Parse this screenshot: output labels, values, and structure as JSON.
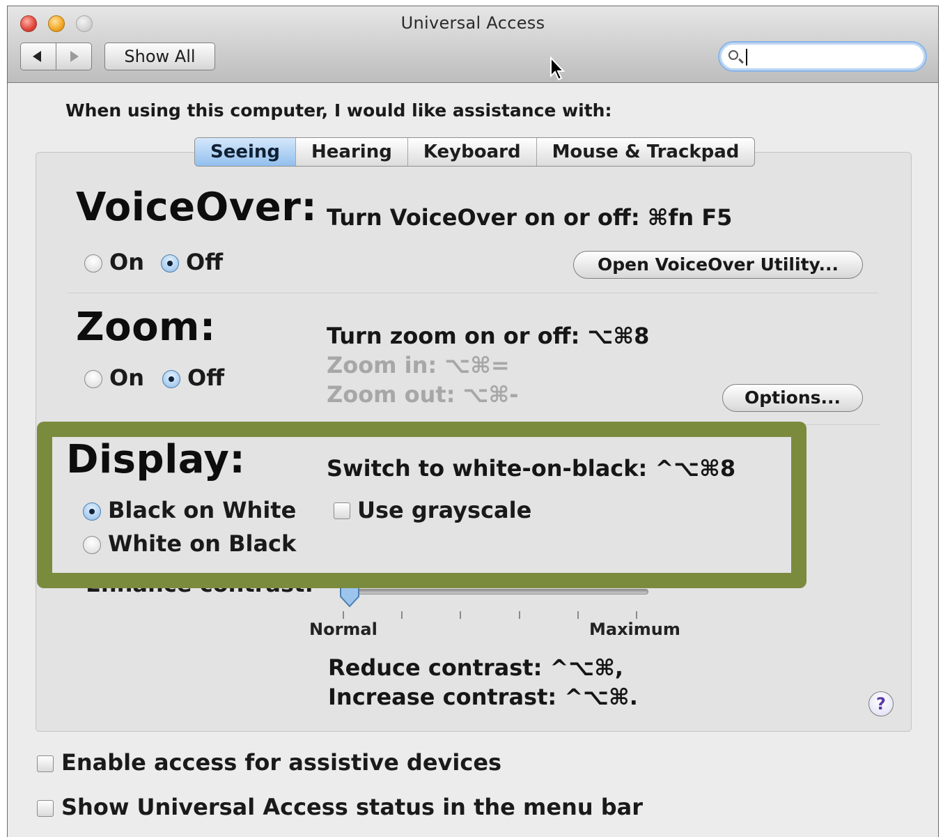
{
  "window": {
    "title": "Universal Access"
  },
  "toolbar": {
    "show_all_label": "Show All",
    "search_value": ""
  },
  "prompt": "When using this computer, I would like assistance with:",
  "tabs": [
    {
      "label": "Seeing",
      "selected": true
    },
    {
      "label": "Hearing",
      "selected": false
    },
    {
      "label": "Keyboard",
      "selected": false
    },
    {
      "label": "Mouse & Trackpad",
      "selected": false
    }
  ],
  "voiceover": {
    "title": "VoiceOver:",
    "shortcut": "Turn VoiceOver on or off: ⌘fn F5",
    "on_label": "On",
    "off_label": "Off",
    "selected": "Off",
    "utility_button": "Open VoiceOver Utility..."
  },
  "zoom": {
    "title": "Zoom:",
    "shortcut": "Turn zoom on or off: ⌥⌘8",
    "zoom_in": "Zoom in: ⌥⌘=",
    "zoom_out": "Zoom out: ⌥⌘-",
    "on_label": "On",
    "off_label": "Off",
    "selected": "Off",
    "options_button": "Options..."
  },
  "display": {
    "title": "Display:",
    "shortcut": "Switch to white-on-black: ^⌥⌘8",
    "black_on_white": "Black on White",
    "white_on_black": "White on Black",
    "selected": "Black on White",
    "grayscale_label": "Use grayscale",
    "grayscale_checked": false,
    "highlight_color": "#7b8b3e"
  },
  "contrast": {
    "label": "Enhance contrast:",
    "min_label": "Normal",
    "max_label": "Maximum",
    "value": 0,
    "reduce": "Reduce contrast: ^⌥⌘,",
    "increase": "Increase contrast: ^⌥⌘."
  },
  "help_icon": "?",
  "footer": {
    "assistive_label": "Enable access for assistive devices",
    "assistive_checked": false,
    "status_label": "Show Universal Access status in the menu bar",
    "status_checked": false
  },
  "colors": {
    "window_bg": "#ececec",
    "tab_active": "#92c0ee",
    "dim_text": "#a7a7a7"
  }
}
